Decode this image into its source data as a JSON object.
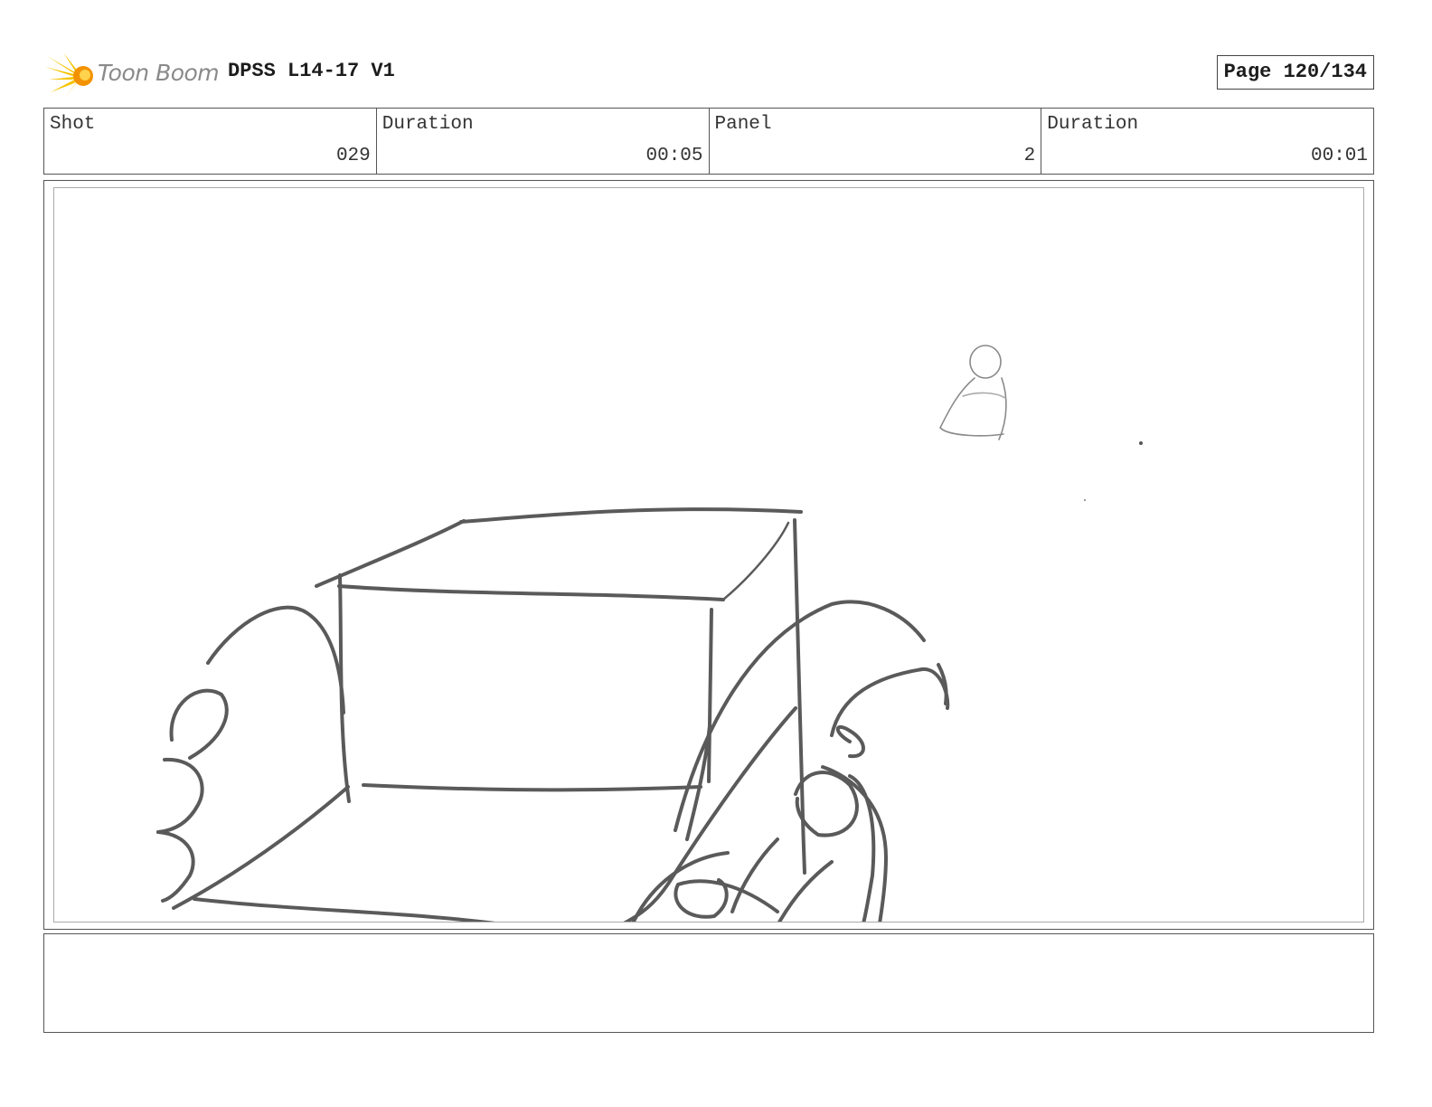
{
  "header": {
    "logo_text": "Toon Boom",
    "title": "DPSS L14-17 V1",
    "page": "Page 120/134"
  },
  "info": {
    "shot_label": "Shot",
    "shot_value": "029",
    "shot_duration_label": "Duration",
    "shot_duration_value": "00:05",
    "panel_label": "Panel",
    "panel_value": "2",
    "panel_duration_label": "Duration",
    "panel_duration_value": "00:01"
  },
  "colors": {
    "sketch_stroke": "#5a5a5a",
    "sketch_light": "#9a9a9a",
    "logo_yellow": "#f5c400",
    "logo_orange": "#f39200"
  },
  "notes": {
    "text": ""
  }
}
